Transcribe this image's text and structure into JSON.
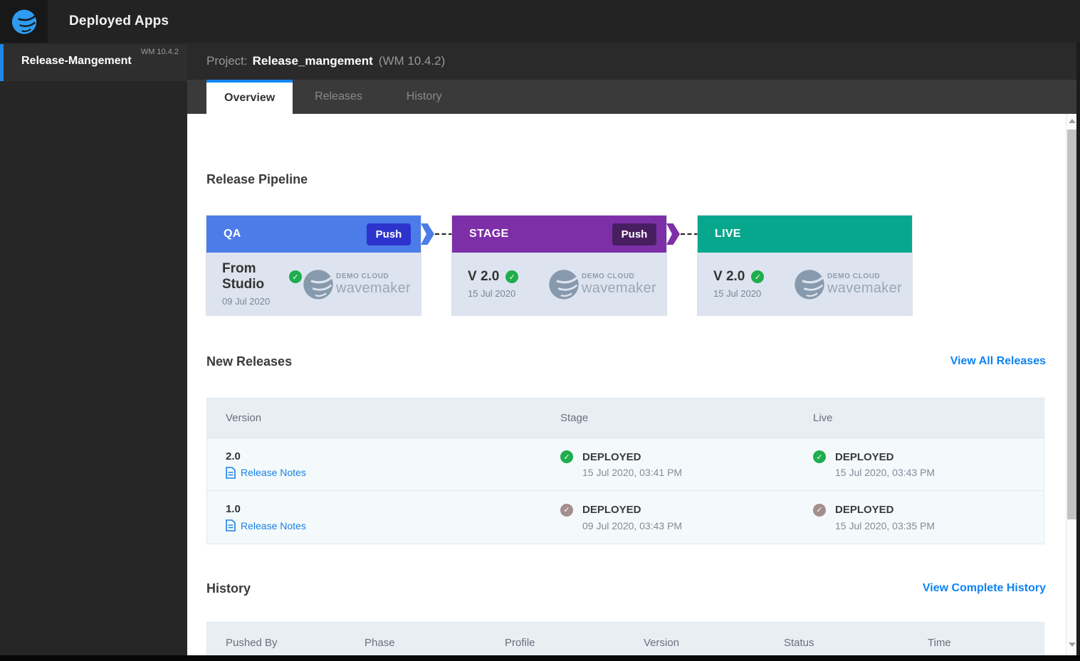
{
  "topbar": {
    "title": "Deployed Apps"
  },
  "sidebar": {
    "project": {
      "name": "Release-Mangement",
      "version": "WM 10.4.2"
    }
  },
  "header": {
    "project_label": "Project:",
    "project_name": "Release_mangement",
    "project_version": "(WM 10.4.2)"
  },
  "tabs": [
    {
      "label": "Overview",
      "active": true
    },
    {
      "label": "Releases",
      "active": false
    },
    {
      "label": "History",
      "active": false
    }
  ],
  "pipeline": {
    "title": "Release Pipeline",
    "logo": {
      "line1": "DEMO CLOUD",
      "line2": "wavemaker"
    },
    "stages": [
      {
        "name": "QA",
        "push_label": "Push",
        "header_color": "#4b7ce8",
        "push_color": "#2c34cd",
        "version": "From Studio",
        "date": "09 Jul 2020",
        "check_color": "#1fad4e"
      },
      {
        "name": "STAGE",
        "push_label": "Push",
        "header_color": "#7d2fa7",
        "push_color": "#471f61",
        "version": "V 2.0",
        "date": "15 Jul 2020",
        "check_color": "#1fad4e"
      },
      {
        "name": "LIVE",
        "push_label": "",
        "header_color": "#06a78c",
        "push_color": "",
        "version": "V 2.0",
        "date": "15 Jul 2020",
        "check_color": "#1fad4e"
      }
    ]
  },
  "new_releases": {
    "title": "New Releases",
    "view_all_label": "View All Releases",
    "columns": [
      "Version",
      "Stage",
      "Live"
    ],
    "release_notes_label": "Release Notes",
    "rows": [
      {
        "version": "2.0",
        "stage": {
          "status": "DEPLOYED",
          "time": "15 Jul 2020, 03:41 PM",
          "check_color": "#1fad4e"
        },
        "live": {
          "status": "DEPLOYED",
          "time": "15 Jul 2020, 03:43 PM",
          "check_color": "#1fad4e"
        }
      },
      {
        "version": "1.0",
        "stage": {
          "status": "DEPLOYED",
          "time": "09 Jul 2020, 03:43 PM",
          "check_color": "#a38f8d"
        },
        "live": {
          "status": "DEPLOYED",
          "time": "15 Jul 2020, 03:35 PM",
          "check_color": "#a38f8d"
        }
      }
    ]
  },
  "history": {
    "title": "History",
    "view_all_label": "View Complete History",
    "columns": [
      "Pushed By",
      "Phase",
      "Profile",
      "Version",
      "Status",
      "Time"
    ]
  },
  "colors": {
    "accent_link": "#0e83f3",
    "tab_active_border": "#1187f2",
    "sidebar_accent": "#1e88e5",
    "success_check": "#1fad4e",
    "stale_check": "#a38f8d"
  },
  "icons": {
    "check": "✓"
  }
}
